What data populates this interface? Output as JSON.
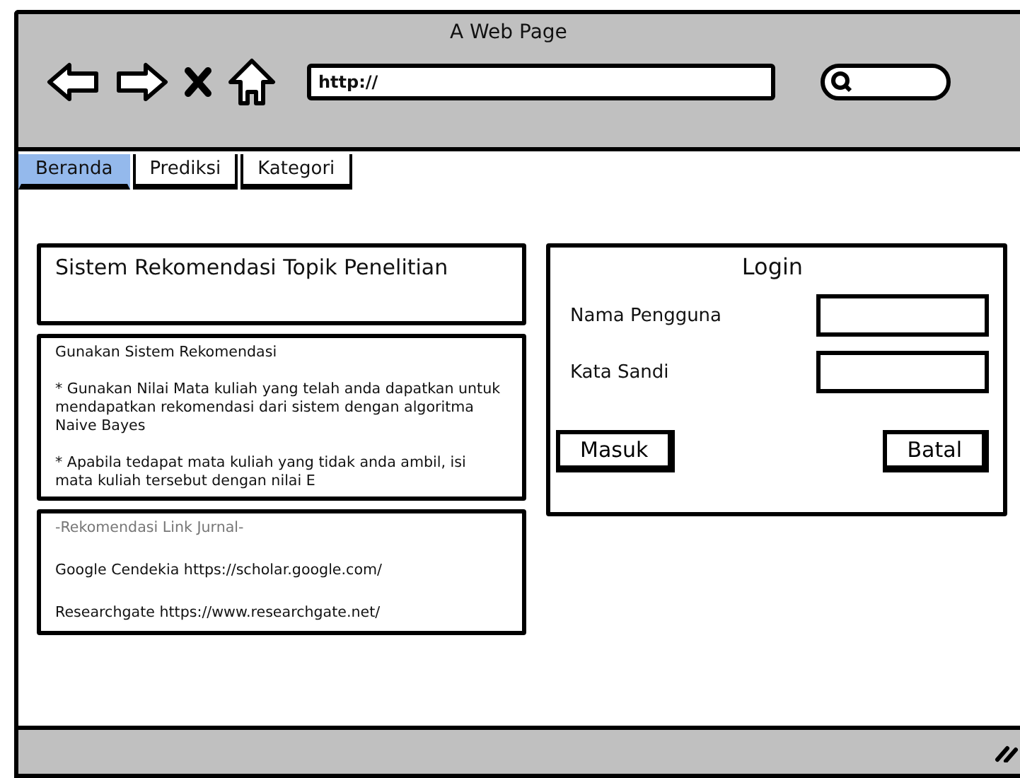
{
  "window": {
    "title": "A Web Page"
  },
  "address_bar": {
    "value": "http://"
  },
  "tabs": [
    {
      "label": "Beranda",
      "selected": true
    },
    {
      "label": "Prediksi",
      "selected": false
    },
    {
      "label": "Kategori",
      "selected": false
    }
  ],
  "title_card": {
    "text": "Sistem Rekomendasi Topik Penelitian"
  },
  "info_card": {
    "heading": "Gunakan Sistem Rekomendasi",
    "paragraphs": [
      "* Gunakan Nilai Mata kuliah yang telah anda dapatkan untuk mendapatkan rekomendasi dari sistem dengan algoritma Naive Bayes",
      "* Apabila tedapat mata kuliah yang tidak anda ambil, isi mata kuliah tersebut dengan nilai E"
    ]
  },
  "links_card": {
    "heading": "-Rekomendasi Link Jurnal-",
    "items": [
      "Google Cendekia https://scholar.google.com/",
      "Researchgate https://www.researchgate.net/"
    ]
  },
  "login": {
    "title": "Login",
    "fields": [
      {
        "label": "Nama Pengguna"
      },
      {
        "label": "Kata Sandi"
      }
    ],
    "buttons": [
      "Masuk",
      "Batal"
    ]
  }
}
